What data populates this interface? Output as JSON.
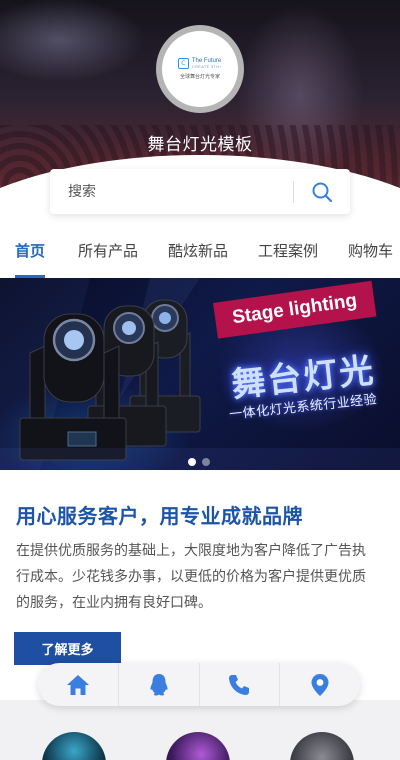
{
  "header": {
    "site_title": "舞台灯光模板",
    "logo": {
      "name": "The Future",
      "sub": "CREATE 9TH+",
      "tagline": "全球舞台灯光专家"
    }
  },
  "search": {
    "placeholder": "搜索",
    "icon": "search-icon"
  },
  "nav": {
    "tabs": [
      {
        "label": "首页",
        "active": true
      },
      {
        "label": "所有产品",
        "active": false
      },
      {
        "label": "酷炫新品",
        "active": false
      },
      {
        "label": "工程案例",
        "active": false
      },
      {
        "label": "购物车",
        "active": false
      }
    ]
  },
  "banner": {
    "tag": "Stage lighting",
    "title": "舞台灯光",
    "subtitle": "一体化灯光系统行业经验",
    "slide_count": 2,
    "active_slide": 1
  },
  "about": {
    "headline": "用心服务客户，用专业成就品牌",
    "description": "在提供优质服务的基础上，大限度地为客户降低了广告执行成本。少花钱多办事，以更低的价格为客户提供更优质的服务，在业内拥有良好口碑。",
    "more_label": "了解更多"
  },
  "bottom_bar": {
    "items": [
      {
        "icon": "home-icon"
      },
      {
        "icon": "qq-icon"
      },
      {
        "icon": "phone-icon"
      },
      {
        "icon": "location-icon"
      }
    ]
  },
  "colors": {
    "accent": "#2369c5",
    "headline": "#1c55a8",
    "button": "#1e4fa2",
    "icon_blue": "#3a7fe0",
    "banner_tag": "#b3124a"
  }
}
